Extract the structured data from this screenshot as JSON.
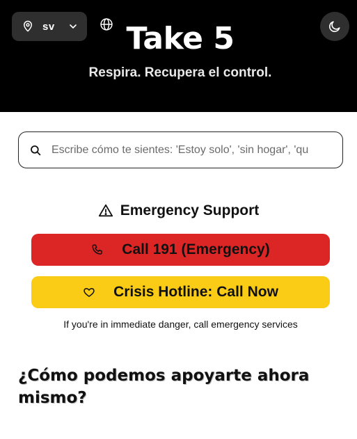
{
  "header": {
    "region_code": "sv",
    "title": "Take 5",
    "subtitle": "Respira. Recupera el control.",
    "icons": [
      "map-pin-icon",
      "chevron-down-icon",
      "globe-icon",
      "moon-icon"
    ]
  },
  "search": {
    "placeholder": "Escribe cómo te sientes: 'Estoy solo', 'sin hogar', 'qu"
  },
  "emergency": {
    "title": "Emergency Support",
    "call_label": "Call 191 (Emergency)",
    "hotline_label": "Crisis Hotline: Call Now",
    "note": "If you're in immediate danger, call emergency services"
  },
  "support": {
    "heading": "¿Cómo podemos apoyarte ahora mismo?"
  },
  "colors": {
    "header_bg": "#000000",
    "emergency_red": "#dc2626",
    "hotline_yellow": "#facc15"
  }
}
